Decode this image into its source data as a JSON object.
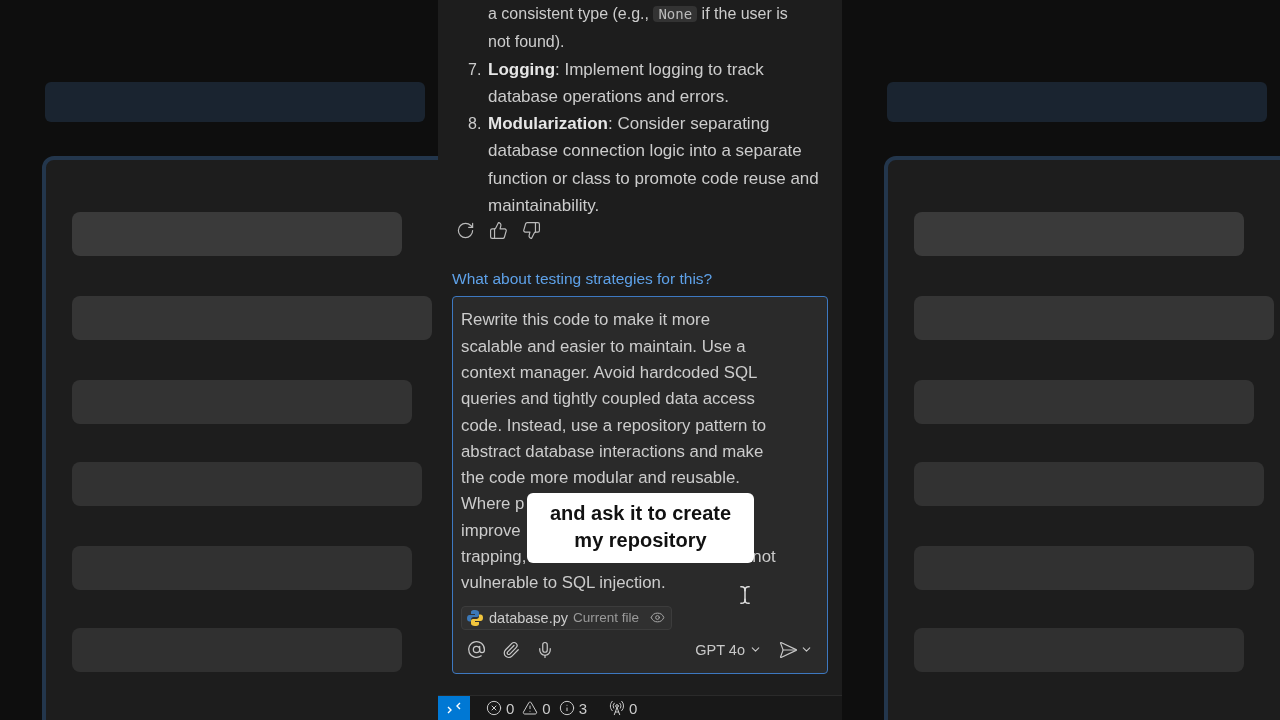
{
  "response": {
    "partial_line": {
      "before": "a consistent type (e.g., ",
      "code": "None",
      "after": " if the user is"
    },
    "continuation": "not found).",
    "items": [
      {
        "number": "7.",
        "text": "**Logging**: Implement logging to track database operations and errors."
      },
      {
        "number": "8.",
        "text": "**Modularization**: Consider separating database connection logic into a separate function or class to promote code reuse and maintainability."
      }
    ]
  },
  "question": "What about testing strategies for this?",
  "prompt": {
    "lines": [
      {
        "text": "Rewrite this code to make it more"
      },
      {
        "text": "scalable and easier to maintain. Use a"
      },
      {
        "text": "context manager. Avoid hardcoded SQL"
      },
      {
        "text": "queries and tightly coupled data access"
      },
      {
        "text": "code. Instead, use a repository pattern to"
      },
      {
        "text": "abstract database interactions and make"
      },
      {
        "text": "the code more modular and reusable."
      },
      {
        "text": "Where p"
      },
      {
        "text": "improve"
      },
      {
        "text": "trapping,",
        "text_right": "not"
      },
      {
        "text": "vulnerable to SQL injection."
      }
    ],
    "attachment": {
      "file": "database.py",
      "note": "Current file"
    },
    "model": "GPT 4o"
  },
  "caption": "and ask it to create my repository",
  "status_bar": {
    "errors": "0",
    "warnings": "0",
    "infos": "3",
    "ports": "0"
  }
}
